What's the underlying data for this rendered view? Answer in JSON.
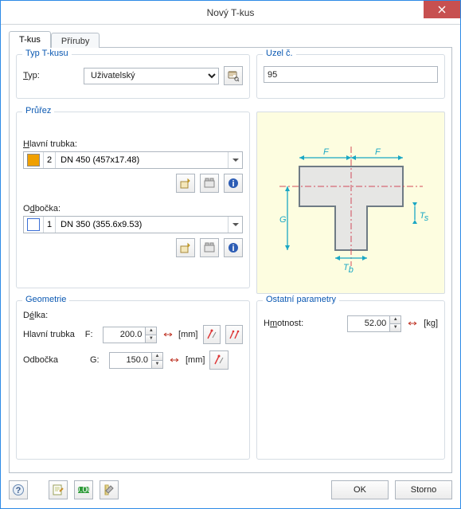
{
  "window": {
    "title": "Nový T-kus"
  },
  "tabs": {
    "active": "T-kus",
    "inactive": "Příruby"
  },
  "type_group": {
    "legend": "Typ T-kusu",
    "label": "Typ:",
    "value": "Uživatelský"
  },
  "node_group": {
    "legend": "Uzel č.",
    "value": "95"
  },
  "section_group": {
    "legend": "Průřez",
    "main_label": "Hlavní trubka:",
    "main_color": "#f0a000",
    "main_index": "2",
    "main_value": "DN 450 (457x17.48)",
    "branch_label": "Odbočka:",
    "branch_color": "#3b6fd6",
    "branch_index": "1",
    "branch_value": "DN 350 (355.6x9.53)"
  },
  "geometry_group": {
    "legend": "Geometrie",
    "length_label": "Délka:",
    "main_label": "Hlavní trubka",
    "main_sym": "F:",
    "main_value": "200.0",
    "branch_label": "Odbočka",
    "branch_sym": "G:",
    "branch_value": "150.0",
    "unit": "[mm]"
  },
  "other_group": {
    "legend": "Ostatní parametry",
    "mass_label": "Hmotnost:",
    "mass_value": "52.00",
    "mass_unit": "[kg]"
  },
  "footer": {
    "ok": "OK",
    "cancel": "Storno"
  }
}
